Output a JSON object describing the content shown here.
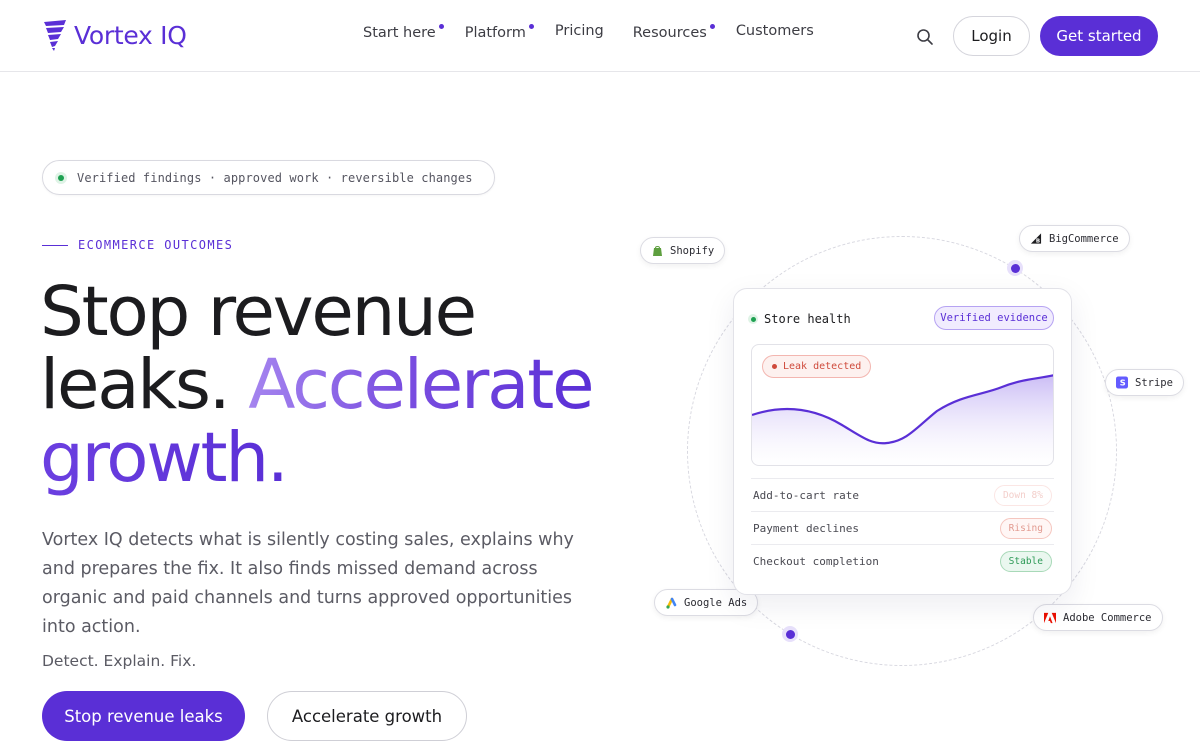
{
  "brand": {
    "name": "Vortex IQ",
    "accent": "#5a2fd6"
  },
  "nav": {
    "items": [
      {
        "label": "Start here",
        "has_indicator": true
      },
      {
        "label": "Platform",
        "has_indicator": true
      },
      {
        "label": "Pricing",
        "has_indicator": false
      },
      {
        "label": "Resources",
        "has_indicator": true
      },
      {
        "label": "Customers",
        "has_indicator": false
      }
    ],
    "search_icon": "search-icon",
    "login_label": "Login",
    "cta_label": "Get started"
  },
  "hero": {
    "trust_text": "Verified findings · approved work · reversible changes",
    "eyebrow": "ECOMMERCE OUTCOMES",
    "headline_line1": "Stop revenue",
    "headline_line2a": "leaks. ",
    "headline_line2b": "Accelerate",
    "headline_line3": "growth.",
    "description": "Vortex IQ detects what is silently costing sales, explains why and prepares the fix. It also finds missed demand across organic and paid channels and turns approved opportunities into action.",
    "tagline": "Detect. Explain. Fix.",
    "primary_button": "Stop revenue leaks",
    "secondary_button": "Accelerate growth"
  },
  "integrations": {
    "shopify": "Shopify",
    "bigcommerce": "BigCommerce",
    "stripe": "Stripe",
    "google_ads": "Google Ads",
    "adobe_commerce": "Adobe Commerce"
  },
  "store_card": {
    "title": "Store health",
    "verified_badge": "Verified evidence",
    "leak_badge": "Leak detected",
    "metrics": [
      {
        "label": "Add-to-cart rate",
        "status": "Down 8%",
        "tone": "faded"
      },
      {
        "label": "Payment declines",
        "status": "Rising",
        "tone": "rising"
      },
      {
        "label": "Checkout completion",
        "status": "Stable",
        "tone": "stable"
      }
    ]
  }
}
